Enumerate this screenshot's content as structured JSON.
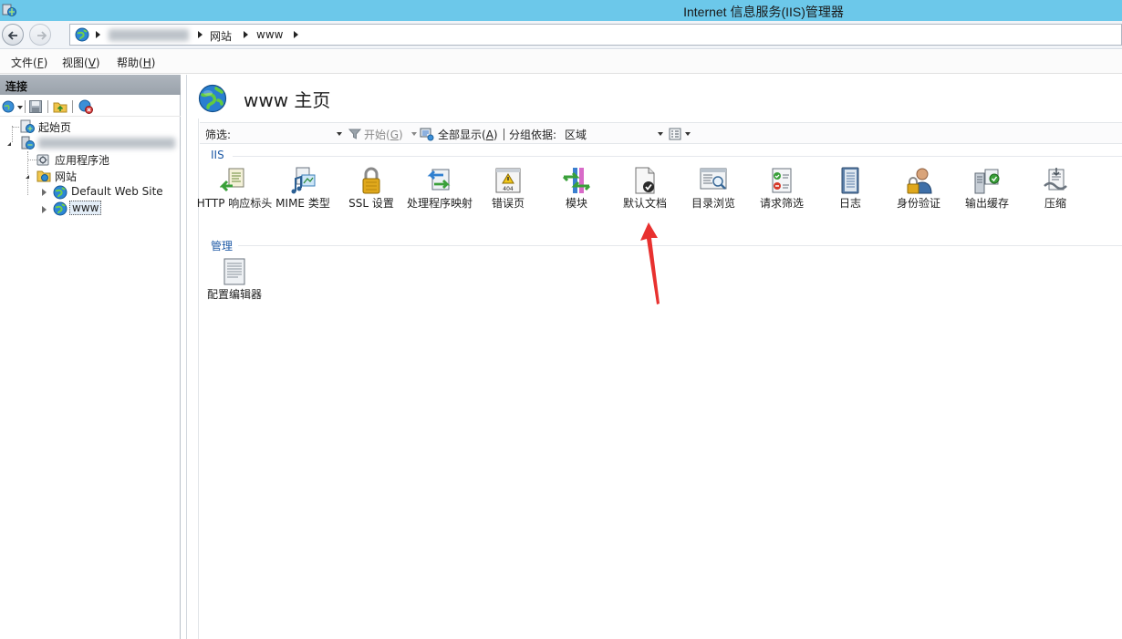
{
  "window": {
    "title": "Internet 信息服务(IIS)管理器",
    "app_icon": "iis-manager-icon"
  },
  "address_bar": {
    "back_icon": "back-arrow-icon",
    "forward_icon": "forward-arrow-icon",
    "globe_icon": "globe-icon",
    "breadcrumbs": [
      "网站",
      "www"
    ]
  },
  "menu": {
    "items": [
      {
        "label": "文件(",
        "key": "F",
        "suffix": ")"
      },
      {
        "label": "视图(",
        "key": "V",
        "suffix": ")"
      },
      {
        "label": "帮助(",
        "key": "H",
        "suffix": ")"
      }
    ]
  },
  "connections": {
    "header": "连接",
    "tree": {
      "start_page": "起始页",
      "app_pools": "应用程序池",
      "sites": "网站",
      "default_site": "Default Web Site",
      "www": "www"
    }
  },
  "main": {
    "heading": "www 主页",
    "filter": {
      "label": "筛选:",
      "start_label": "开始(",
      "start_key": "G",
      "start_suffix": ")",
      "show_all_label": "全部显示(",
      "show_all_key": "A",
      "show_all_suffix": ")",
      "group_by_label": "分组依据:",
      "group_by_value": "区域"
    },
    "sections": [
      {
        "title": "IIS",
        "features": [
          {
            "label": "HTTP 响应标头",
            "icon": "http-response-headers-icon"
          },
          {
            "label": "MIME 类型",
            "icon": "mime-types-icon"
          },
          {
            "label": "SSL 设置",
            "icon": "ssl-lock-icon"
          },
          {
            "label": "处理程序映射",
            "icon": "handler-mappings-icon"
          },
          {
            "label": "错误页",
            "icon": "error-pages-icon"
          },
          {
            "label": "模块",
            "icon": "modules-icon"
          },
          {
            "label": "默认文档",
            "icon": "default-document-icon"
          },
          {
            "label": "目录浏览",
            "icon": "directory-browsing-icon"
          },
          {
            "label": "请求筛选",
            "icon": "request-filtering-icon"
          },
          {
            "label": "日志",
            "icon": "logging-icon"
          },
          {
            "label": "身份验证",
            "icon": "authentication-icon"
          },
          {
            "label": "输出缓存",
            "icon": "output-caching-icon"
          },
          {
            "label": "压缩",
            "icon": "compression-icon"
          }
        ]
      },
      {
        "title": "管理",
        "features": [
          {
            "label": "配置编辑器",
            "icon": "configuration-editor-icon"
          }
        ]
      }
    ]
  },
  "colors": {
    "titlebar": "#6cc8ea",
    "section_title": "#1f5aa6",
    "annotation_arrow": "#e8312f"
  }
}
